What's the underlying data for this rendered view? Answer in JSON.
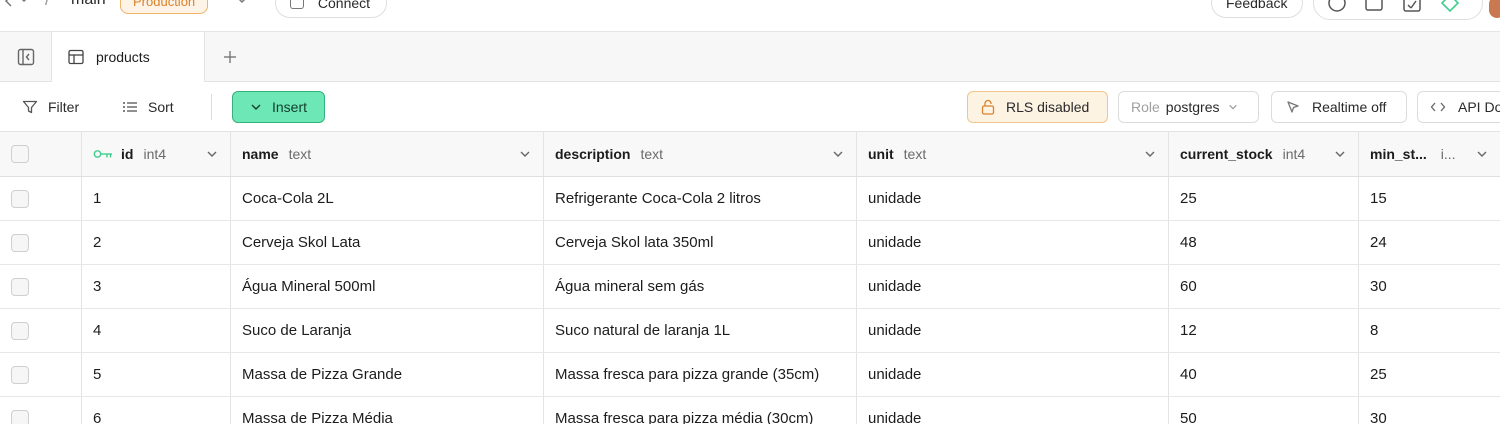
{
  "topbar": {
    "branch": "main",
    "environment_badge": "Production",
    "connect_label": "Connect",
    "feedback_label": "Feedback"
  },
  "tabs": [
    {
      "label": "products",
      "icon": "table-icon"
    }
  ],
  "toolbar": {
    "filter_label": "Filter",
    "sort_label": "Sort",
    "insert_label": "Insert",
    "rls_label": "RLS disabled",
    "role_prefix": "Role",
    "role_value": "postgres",
    "realtime_label": "Realtime off",
    "api_docs_label": "API Do"
  },
  "table": {
    "columns": [
      {
        "name": "id",
        "type": "int4",
        "primary_key": true
      },
      {
        "name": "name",
        "type": "text"
      },
      {
        "name": "description",
        "type": "text"
      },
      {
        "name": "unit",
        "type": "text"
      },
      {
        "name": "current_stock",
        "type": "int4"
      },
      {
        "name": "min_st...",
        "type": "i..."
      }
    ],
    "rows": [
      {
        "id": "1",
        "name": "Coca-Cola 2L",
        "description": "Refrigerante Coca-Cola 2 litros",
        "unit": "unidade",
        "current_stock": "25",
        "min_stock": "15"
      },
      {
        "id": "2",
        "name": "Cerveja Skol Lata",
        "description": "Cerveja Skol lata 350ml",
        "unit": "unidade",
        "current_stock": "48",
        "min_stock": "24"
      },
      {
        "id": "3",
        "name": "Água Mineral 500ml",
        "description": "Água mineral sem gás",
        "unit": "unidade",
        "current_stock": "60",
        "min_stock": "30"
      },
      {
        "id": "4",
        "name": "Suco de Laranja",
        "description": "Suco natural de laranja 1L",
        "unit": "unidade",
        "current_stock": "12",
        "min_stock": "8"
      },
      {
        "id": "5",
        "name": "Massa de Pizza Grande",
        "description": "Massa fresca para pizza grande (35cm)",
        "unit": "unidade",
        "current_stock": "40",
        "min_stock": "25"
      },
      {
        "id": "6",
        "name": "Massa de Pizza Média",
        "description": "Massa fresca para pizza média (30cm)",
        "unit": "unidade",
        "current_stock": "50",
        "min_stock": "30"
      }
    ]
  },
  "colors": {
    "insert_bg": "#6ee7b7",
    "badge_orange": "#d9822b",
    "rls_bg": "#fdf3e3",
    "primary_key_green": "#3ecf8e"
  }
}
